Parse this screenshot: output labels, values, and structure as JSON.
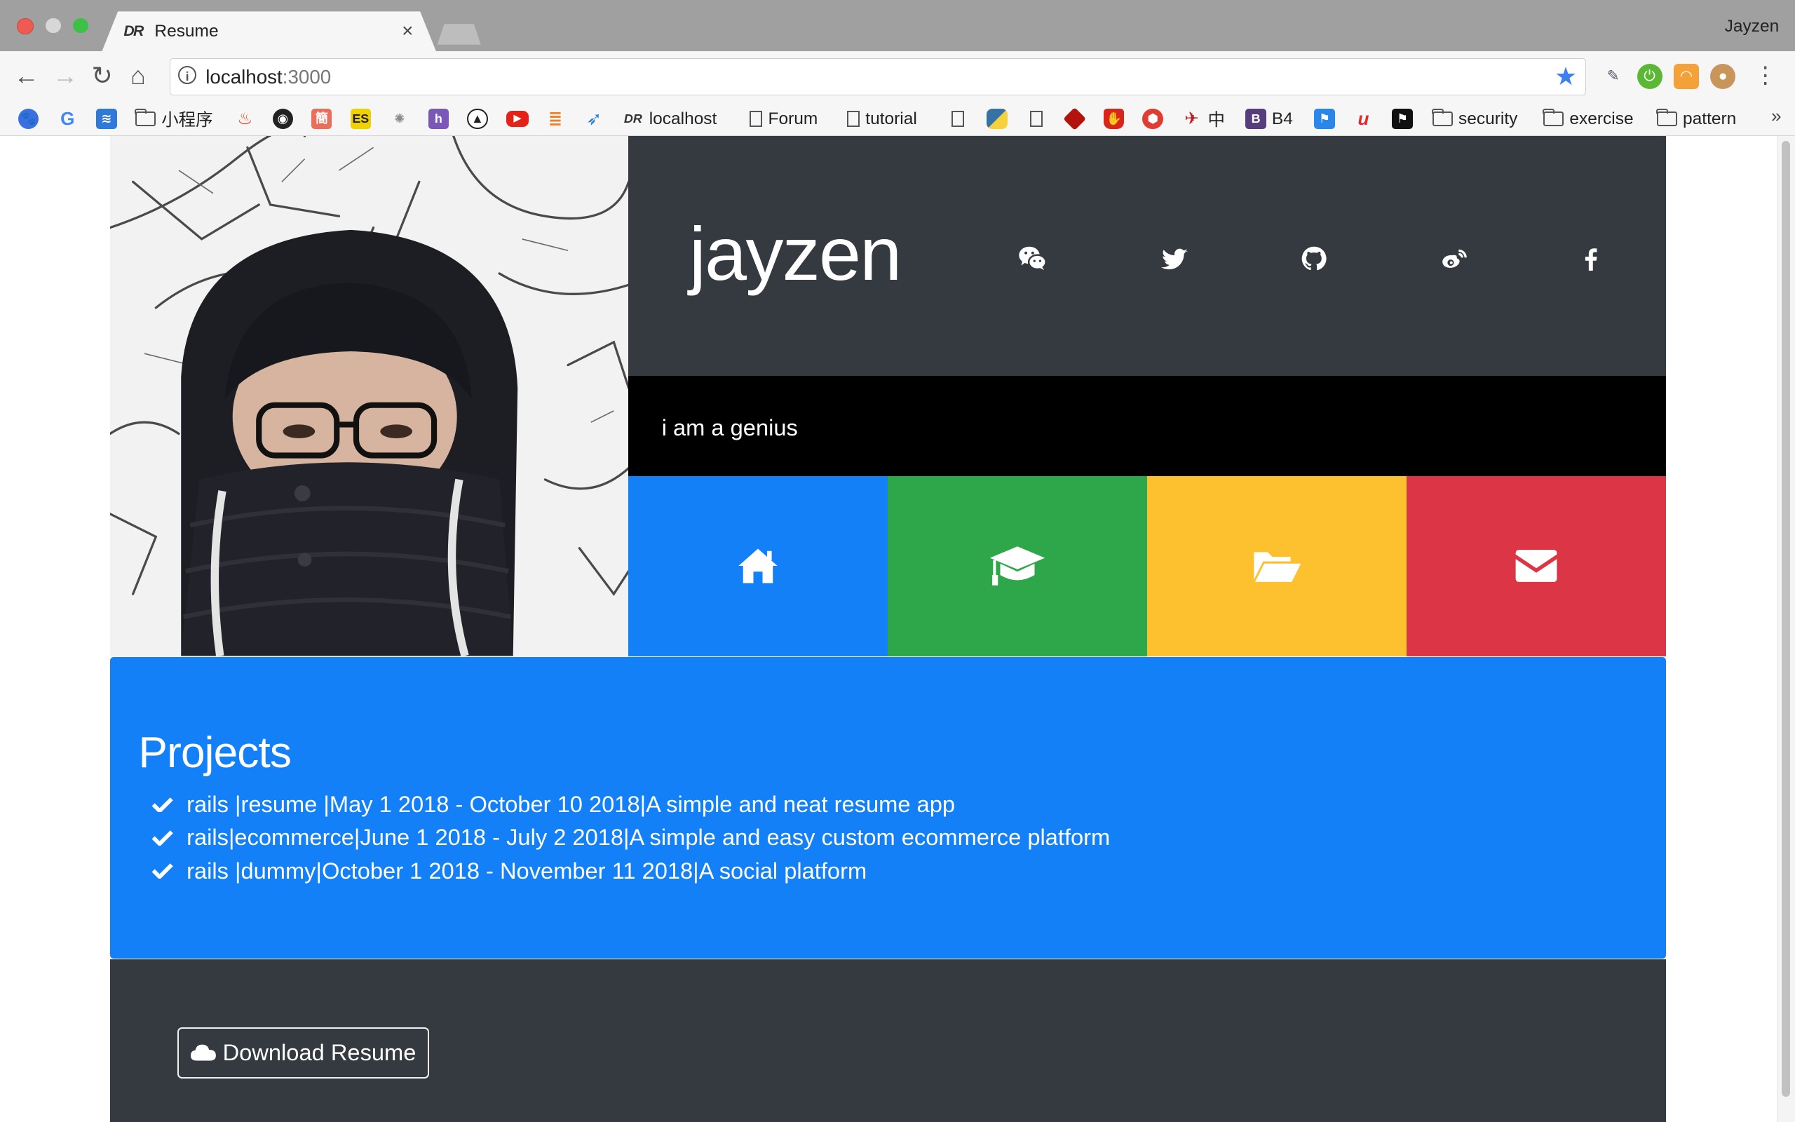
{
  "browser": {
    "tab_title": "Resume",
    "tab_favicon_text": "DR",
    "profile_name": "Jayzen",
    "url_host": "localhost",
    "url_port": ":3000",
    "bookmarks": [
      {
        "label": "",
        "icon": "baidu-icon"
      },
      {
        "label": "",
        "icon": "google-icon"
      },
      {
        "label": "",
        "icon": "layers-icon"
      },
      {
        "label": "小程序",
        "icon": "folder-icon"
      },
      {
        "label": "",
        "icon": "flame-icon"
      },
      {
        "label": "",
        "icon": "github-icon"
      },
      {
        "label": "簡",
        "icon": "jianshu-icon"
      },
      {
        "label": "ES",
        "icon": "es-icon"
      },
      {
        "label": "",
        "icon": "bug-icon"
      },
      {
        "label": "h",
        "icon": "h-icon"
      },
      {
        "label": "",
        "icon": "compass-icon"
      },
      {
        "label": "",
        "icon": "youtube-icon"
      },
      {
        "label": "",
        "icon": "stackoverflow-icon"
      },
      {
        "label": "",
        "icon": "rocket-icon"
      },
      {
        "label": "localhost",
        "icon": "dr-icon"
      },
      {
        "label": "Forum",
        "icon": "doc-icon"
      },
      {
        "label": "tutorial",
        "icon": "doc-icon"
      },
      {
        "label": "",
        "icon": "doc-icon"
      },
      {
        "label": "",
        "icon": "python-icon"
      },
      {
        "label": "",
        "icon": "doc-icon"
      },
      {
        "label": "",
        "icon": "ruby-icon"
      },
      {
        "label": "",
        "icon": "hand-icon"
      },
      {
        "label": "",
        "icon": "shield-icon"
      },
      {
        "label": "中",
        "icon": "bird-icon"
      },
      {
        "label": "B4",
        "icon": "bootstrap-icon"
      },
      {
        "label": "",
        "icon": "flag-icon"
      },
      {
        "label": "",
        "icon": "u-icon"
      },
      {
        "label": "",
        "icon": "box-flag-icon"
      },
      {
        "label": "security",
        "icon": "folder-icon"
      },
      {
        "label": "exercise",
        "icon": "folder-icon"
      },
      {
        "label": "pattern",
        "icon": "folder-icon"
      }
    ],
    "bookmarks_more": "»"
  },
  "profile": {
    "name": "jayzen",
    "tagline": "i am a genius",
    "social": [
      "wechat-icon",
      "twitter-icon",
      "github-icon",
      "weibo-icon",
      "facebook-icon"
    ]
  },
  "tiles": [
    {
      "icon": "home-icon",
      "color": "#1480f8"
    },
    {
      "icon": "graduation-cap-icon",
      "color": "#2ea74a"
    },
    {
      "icon": "folder-open-icon",
      "color": "#fdc02f"
    },
    {
      "icon": "envelope-icon",
      "color": "#dc3545"
    }
  ],
  "projects": {
    "heading": "Projects",
    "items": [
      "rails |resume |May 1 2018 - October 10 2018|A simple and neat resume app",
      "rails|ecommerce|June 1 2018 - July 2 2018|A simple and easy custom ecommerce platform",
      "rails |dummy|October 1 2018 - November 11 2018|A social platform"
    ]
  },
  "footer": {
    "download_label": "Download Resume"
  }
}
